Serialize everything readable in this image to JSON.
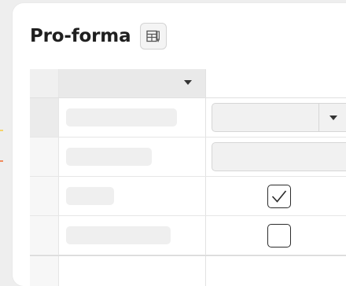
{
  "page": {
    "title": "Pro-forma",
    "accent_marks": [
      "#f5d36a",
      "#f08a5d"
    ]
  },
  "toolbar": {
    "table_view_icon": "table-view-icon"
  },
  "grid": {
    "columns": [
      {
        "header": "",
        "has_dropdown": true
      },
      {
        "header": "",
        "has_dropdown": true
      }
    ],
    "rows": [
      {
        "col_b_type": "dropdown",
        "selected": true
      },
      {
        "col_b_type": "text-input",
        "selected": false
      },
      {
        "col_b_type": "checkbox",
        "checked": true,
        "selected": false
      },
      {
        "col_b_type": "checkbox",
        "checked": false,
        "selected": false
      },
      {
        "col_b_type": "empty",
        "selected": false
      }
    ]
  }
}
